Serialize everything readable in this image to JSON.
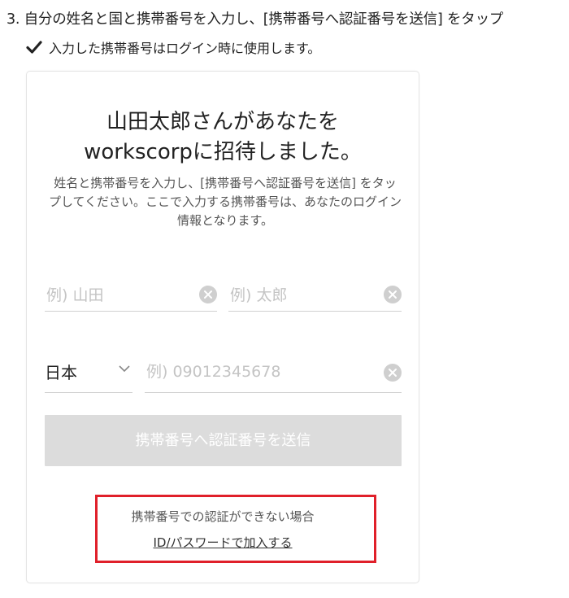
{
  "instructions": {
    "step": "3. 自分の姓名と国と携帯番号を入力し、[携帯番号へ認証番号を送信] をタップ",
    "note": "入力した携帯番号はログイン時に使用します。"
  },
  "card": {
    "title_line1": "山田太郎さんがあなたを",
    "title_line2": "workscorpに招待しました。",
    "description": "姓名と携帯番号を入力し、[携帯番号へ認証番号を送信] をタップしてください。ここで入力する携帯番号は、あなたのログイン情報となります。",
    "last_name_placeholder": "例) 山田",
    "first_name_placeholder": "例) 太郎",
    "country": "日本",
    "phone_placeholder": "例) 09012345678",
    "send_button": "携帯番号へ認証番号を送信",
    "alt_text": "携帯番号での認証ができない場合",
    "alt_link": "ID/パスワードで加入する"
  },
  "colors": {
    "highlight_border": "#e0202a",
    "button_disabled": "#dcdcdc"
  },
  "icons": [
    "check-icon",
    "clear-icon",
    "chevron-down-icon"
  ]
}
